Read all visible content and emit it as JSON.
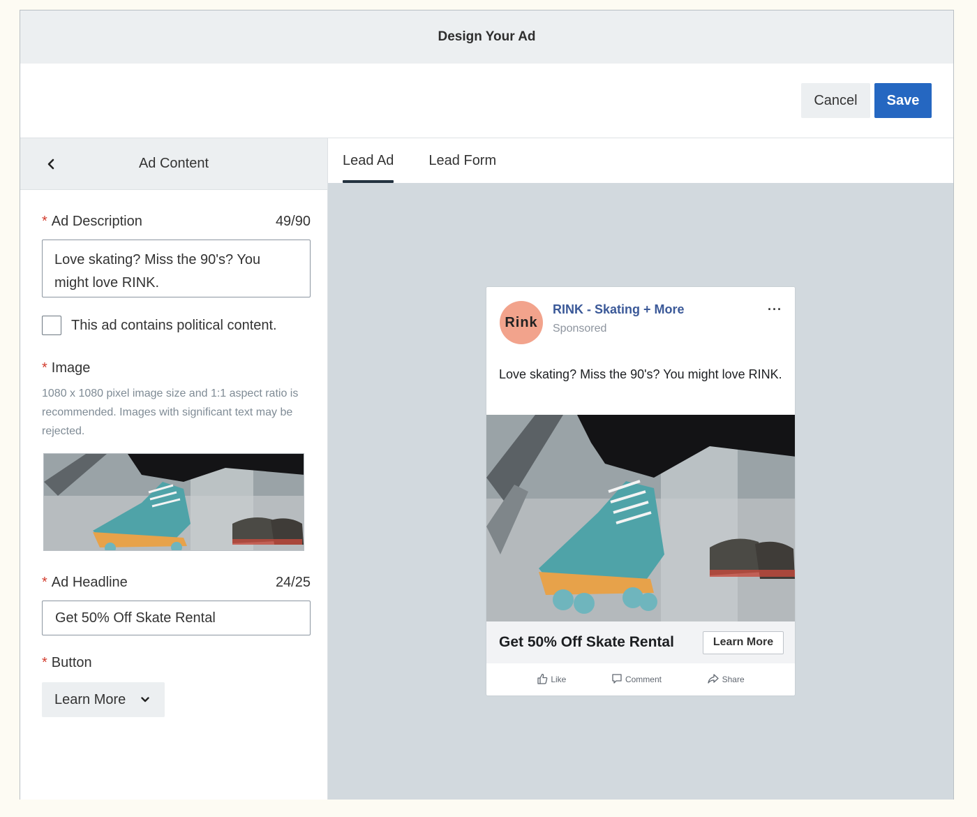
{
  "window": {
    "title": "Design Your Ad"
  },
  "toolbar": {
    "cancel_label": "Cancel",
    "save_label": "Save"
  },
  "left_panel": {
    "title": "Ad Content",
    "description": {
      "label": "Ad Description",
      "count": "49/90",
      "value": "Love skating? Miss the 90's? You might love RINK."
    },
    "political": {
      "label": "This ad contains political content.",
      "checked": false
    },
    "image": {
      "label": "Image",
      "hint": "1080 x 1080 pixel image size and 1:1 aspect ratio is recommended. Images with significant text may be rejected."
    },
    "headline": {
      "label": "Ad Headline",
      "count": "24/25",
      "value": "Get 50% Off Skate Rental"
    },
    "button": {
      "label": "Button",
      "selected": "Learn More"
    }
  },
  "tabs": [
    {
      "label": "Lead Ad",
      "active": true
    },
    {
      "label": "Lead Form",
      "active": false
    }
  ],
  "preview": {
    "avatar_text": "Rink",
    "page_name": "RINK - Skating + More",
    "sponsored": "Sponsored",
    "more": "···",
    "description": "Love skating? Miss the 90's? You might love RINK.",
    "headline": "Get 50% Off Skate Rental",
    "cta": "Learn More",
    "actions": {
      "like": "Like",
      "comment": "Comment",
      "share": "Share"
    }
  },
  "colors": {
    "accent": "#2567c1",
    "brand_page_name": "#3b5998",
    "avatar": "#f2a38c",
    "required": "#d23b2d",
    "preview_bg": "#d2d9de"
  }
}
